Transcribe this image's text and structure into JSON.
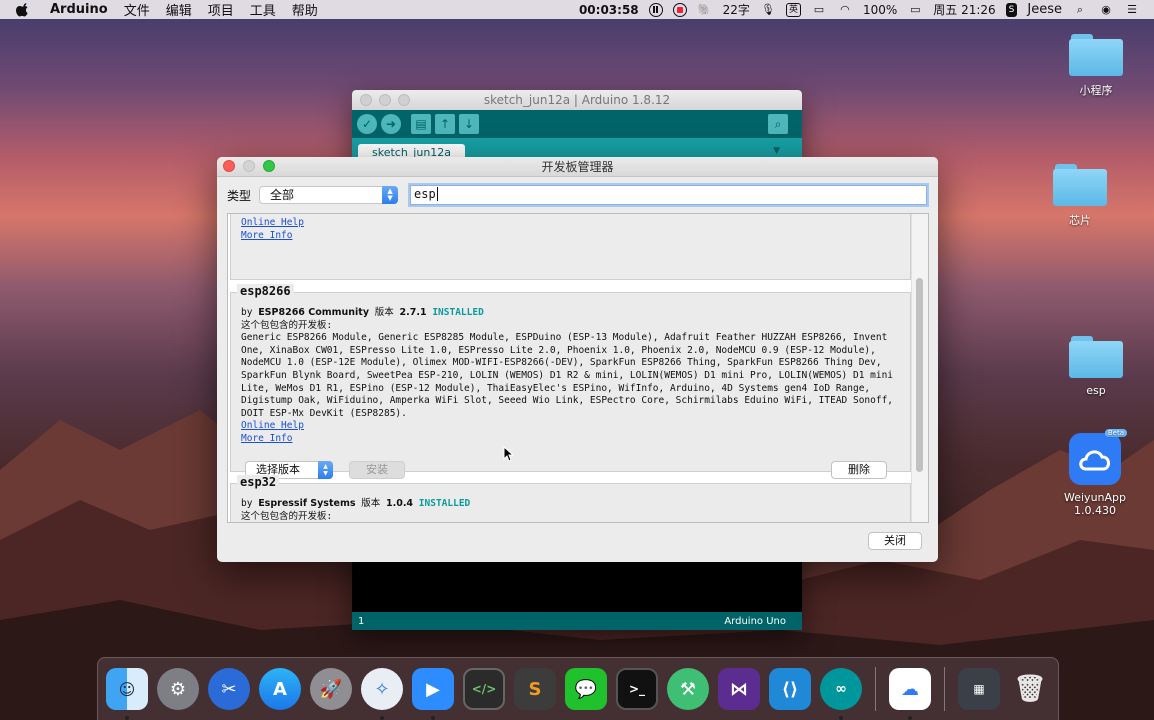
{
  "menubar": {
    "app_name": "Arduino",
    "menus": [
      "文件",
      "编辑",
      "项目",
      "工具",
      "帮助"
    ],
    "clock_timer": "00:03:58",
    "word_count": "22字",
    "battery": "100%",
    "datetime": "周五 21:26",
    "user": "Jeese"
  },
  "desktop": {
    "icons": [
      {
        "label": "小程序"
      },
      {
        "label": "芯片"
      },
      {
        "label": "esp"
      },
      {
        "label": "WeiyunApp\n1.0.430",
        "line1": "WeiyunApp",
        "line2": "1.0.430",
        "badge": "Beta"
      }
    ]
  },
  "arduino_window": {
    "title": "sketch_jun12a | Arduino 1.8.12",
    "tab": "sketch_jun12a",
    "status_line": "1",
    "status_board": "Arduino Uno"
  },
  "board_manager": {
    "title": "开发板管理器",
    "filter_label": "类型",
    "filter_value": "全部",
    "search_value": "esp",
    "top_card": {
      "online_help": "Online Help",
      "more_info": "More Info"
    },
    "esp8266": {
      "name": "esp8266",
      "by_prefix": "by",
      "author": "ESP8266 Community",
      "version_label": "版本",
      "version": "2.7.1",
      "installed": "INSTALLED",
      "boards_heading": "这个包包含的开发板:",
      "boards": "Generic ESP8266 Module, Generic ESP8285 Module, ESPDuino (ESP-13 Module), Adafruit Feather HUZZAH ESP8266, Invent One, XinaBox CW01, ESPresso Lite 1.0, ESPresso Lite 2.0, Phoenix 1.0, Phoenix 2.0, NodeMCU 0.9 (ESP-12 Module), NodeMCU 1.0 (ESP-12E Module), Olimex MOD-WIFI-ESP8266(-DEV), SparkFun ESP8266 Thing, SparkFun ESP8266 Thing Dev, SparkFun Blynk Board, SweetPea ESP-210, LOLIN (WEMOS) D1 R2 & mini, LOLIN(WEMOS) D1 mini Pro, LOLIN(WEMOS) D1 mini Lite, WeMos D1 R1, ESPino (ESP-12 Module), ThaiEasyElec's ESPino, WifInfo, Arduino, 4D Systems gen4 IoD Range, Digistump Oak, WiFiduino, Amperka WiFi Slot, Seeed Wio Link, ESPectro Core, Schirmilabs Eduino WiFi, ITEAD Sonoff, DOIT ESP-Mx DevKit (ESP8285).",
      "online_help": "Online Help",
      "more_info": "More Info",
      "select_version": "选择版本",
      "install": "安装",
      "remove": "删除"
    },
    "esp32": {
      "name": "esp32",
      "by_prefix": "by",
      "author": "Espressif Systems",
      "version_label": "版本",
      "version": "1.0.4",
      "installed": "INSTALLED",
      "boards_heading": "这个包包含的开发板:"
    },
    "close": "关闭"
  },
  "dock": {
    "apps": [
      "finder-icon",
      "system-preferences-icon",
      "xmind-icon",
      "app-store-icon",
      "launchpad-icon",
      "safari-icon",
      "zoom-icon",
      "code-editor-icon",
      "sublime-text-icon",
      "wechat-icon",
      "terminal-icon",
      "android-studio-icon",
      "visual-studio-icon",
      "vscode-icon",
      "arduino-icon",
      "weiyun-icon",
      "screen-capture-icon",
      "trash-icon"
    ]
  }
}
